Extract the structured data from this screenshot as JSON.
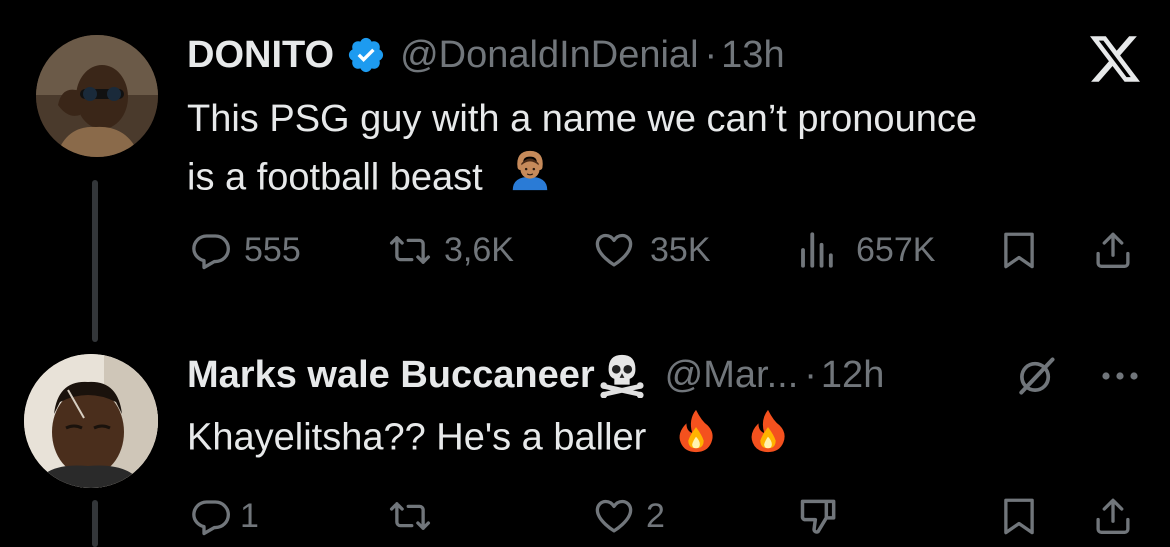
{
  "tweet": {
    "display_name": "DONITO",
    "handle": "@DonaldInDenial",
    "separator": "·",
    "time": "13h",
    "text_line1": "This PSG guy with a name we can’t pronounce",
    "text_line2": "is a football beast",
    "text_emoji": "🙆🏽‍♂️",
    "verified": true,
    "platform_icon": "x-logo-icon",
    "actions": {
      "replies": "555",
      "reposts": "3,6K",
      "likes": "35K",
      "views": "657K"
    }
  },
  "reply": {
    "display_name": "Marks wale Buccaneer",
    "name_emoji": "☠️",
    "handle": "@Mar...",
    "separator": "·",
    "time": "12h",
    "text": "Khayelitsha?? He's a baller",
    "text_emojis": [
      "🔥",
      "🔥"
    ],
    "actions": {
      "replies": "1",
      "reposts": "",
      "likes": "2"
    }
  },
  "colors": {
    "background": "#000000",
    "primary_text": "#e7e9ea",
    "secondary_text": "#71767b",
    "verified_blue": "#1d9bf0",
    "thread_line": "#333639"
  }
}
